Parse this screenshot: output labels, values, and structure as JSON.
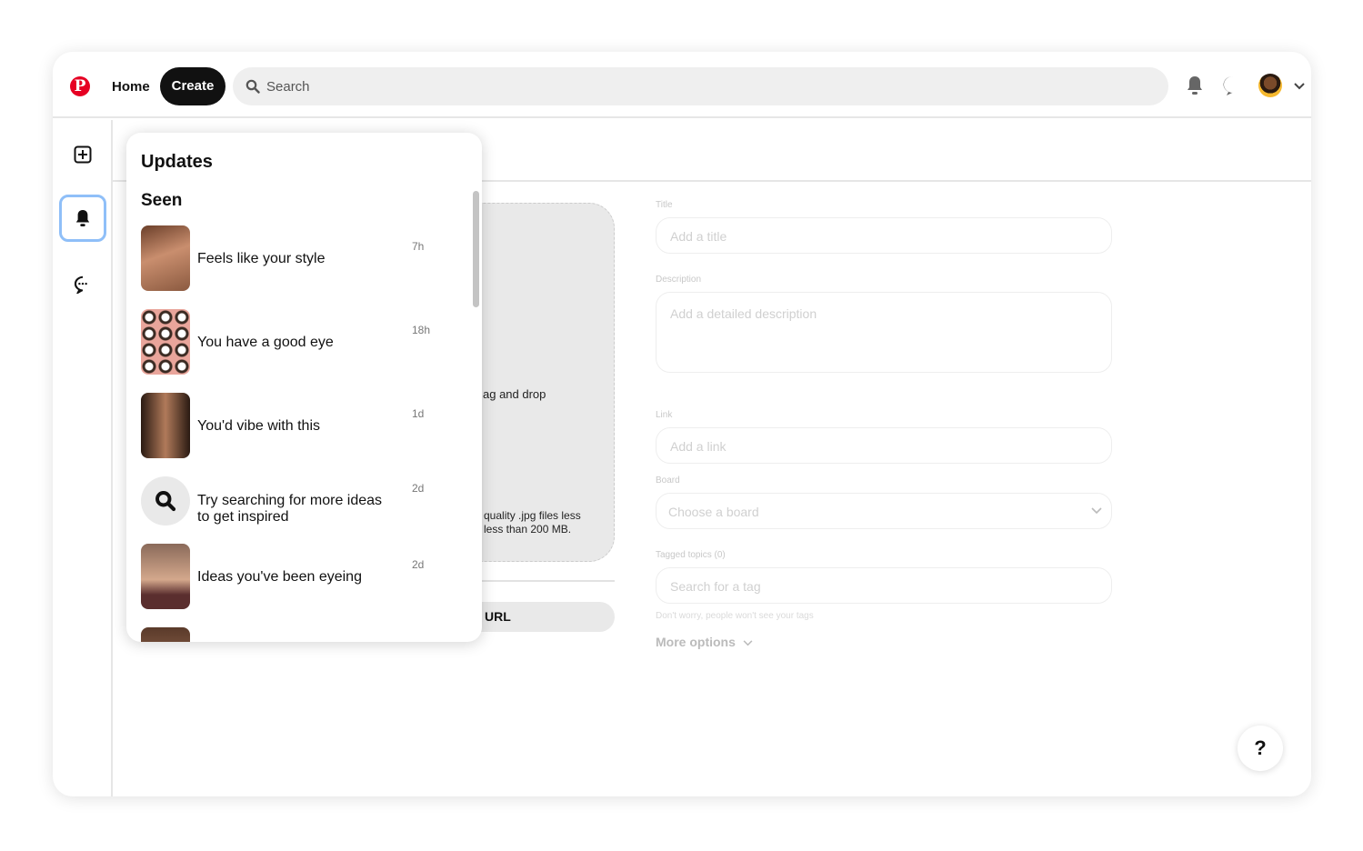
{
  "header": {
    "logo": "P",
    "home": "Home",
    "create": "Create",
    "search_placeholder": "Search"
  },
  "sidebar": {
    "items": [
      {
        "icon": "plus-square-icon"
      },
      {
        "icon": "bell-icon",
        "active": true
      },
      {
        "icon": "chat-icon"
      }
    ]
  },
  "upload": {
    "drag_text": "ag and drop",
    "quality_line1": "quality .jpg files less",
    "quality_line2": "less than 200 MB.",
    "url_button": "URL"
  },
  "form": {
    "title_label": "Title",
    "title_placeholder": "Add a title",
    "description_label": "Description",
    "description_placeholder": "Add a detailed description",
    "link_label": "Link",
    "link_placeholder": "Add a link",
    "board_label": "Board",
    "board_placeholder": "Choose a board",
    "tags_label": "Tagged topics (0)",
    "tags_placeholder": "Search for a tag",
    "tags_hint": "Don't worry, people won't see your tags",
    "more_options": "More options"
  },
  "help": "?",
  "updates": {
    "title": "Updates",
    "section": "Seen",
    "items": [
      {
        "text": "Feels like your style",
        "time": "7h"
      },
      {
        "text": "You have a good eye",
        "time": "18h"
      },
      {
        "text": "You'd vibe with this",
        "time": "1d"
      },
      {
        "text": "Try searching for more ideas to get inspired",
        "time": "2d"
      },
      {
        "text": "Ideas you've been eyeing",
        "time": "2d"
      }
    ]
  },
  "colors": {
    "brand": "#e60023",
    "active_outline": "#8fbff8"
  }
}
